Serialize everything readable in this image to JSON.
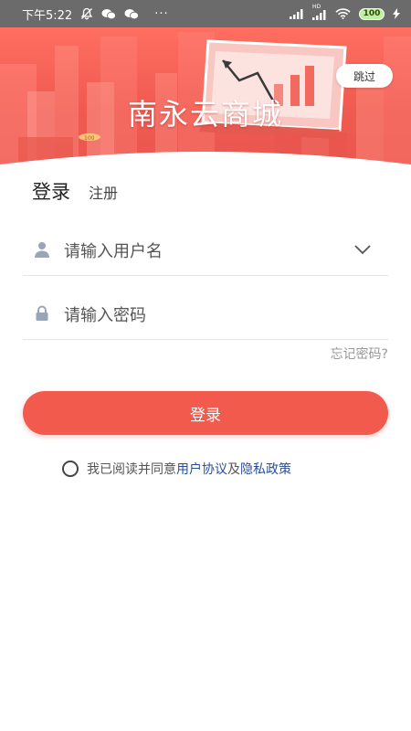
{
  "status_bar": {
    "time": "下午5:22",
    "more": "···",
    "network": "HD",
    "battery": "100"
  },
  "banner": {
    "title": "南永云商城",
    "skip_label": "跳过",
    "coin_label": "100",
    "colors": {
      "primary": "#f25a4e",
      "light": "#ff6e61"
    }
  },
  "tabs": {
    "login": "登录",
    "register": "注册"
  },
  "form": {
    "username_placeholder": "请输入用户名",
    "username_value": "",
    "password_placeholder": "请输入密码",
    "password_value": "",
    "forgot_label": "忘记密码?",
    "login_button": "登录"
  },
  "agreement": {
    "prefix": "我已阅读并同意",
    "user_agreement": "用户协议",
    "conjunction": "及",
    "privacy_policy": "隐私政策",
    "checked": false
  }
}
